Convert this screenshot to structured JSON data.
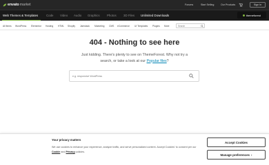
{
  "colors": {
    "topbar": "#262626",
    "catbar": "#1a1a1a",
    "accent": "#82b440",
    "link": "#0084b4"
  },
  "header": {
    "logo_main": "envato",
    "logo_sub": "market",
    "links": [
      "Forums",
      "Start Selling",
      "Our Products"
    ],
    "signin_label": "Sign In"
  },
  "categories": {
    "items": [
      "Web Themes & Templates",
      "Code",
      "Video",
      "Audio",
      "Graphics",
      "Photos",
      "3D Files"
    ],
    "unlimited_label": "Unlimited Downloads",
    "badge_label": "themeforest"
  },
  "subnav": {
    "items": [
      "All Items",
      "WordPress",
      "Elementor",
      "Hosting",
      "HTML",
      "Shopify",
      "Jamstack",
      "Marketing",
      "CMS",
      "eCommerce",
      "UI Templates",
      "Plugins",
      "More"
    ],
    "search_placeholder": "Search"
  },
  "main": {
    "title": "404 - Nothing to see here",
    "lead_text": "Just kidding. There's plenty to see on ThemeForest. Why not try a search, or take a look at our ",
    "lead_link": "Popular files",
    "lead_end": "?",
    "search_placeholder": "e.g. responsive WordPress"
  },
  "cookie": {
    "title": "Your privacy matters",
    "text_start": "We use cookies to enhance your experience, analyze traffic, and serve personalized content. Accept Cookies' to consent per our ",
    "cookies_link": "Cookie",
    "text_and": " and ",
    "privacy_link": "Privacy",
    "text_end": " policies.",
    "accept_label": "Accept Cookies",
    "manage_label": "Manage preferences"
  }
}
